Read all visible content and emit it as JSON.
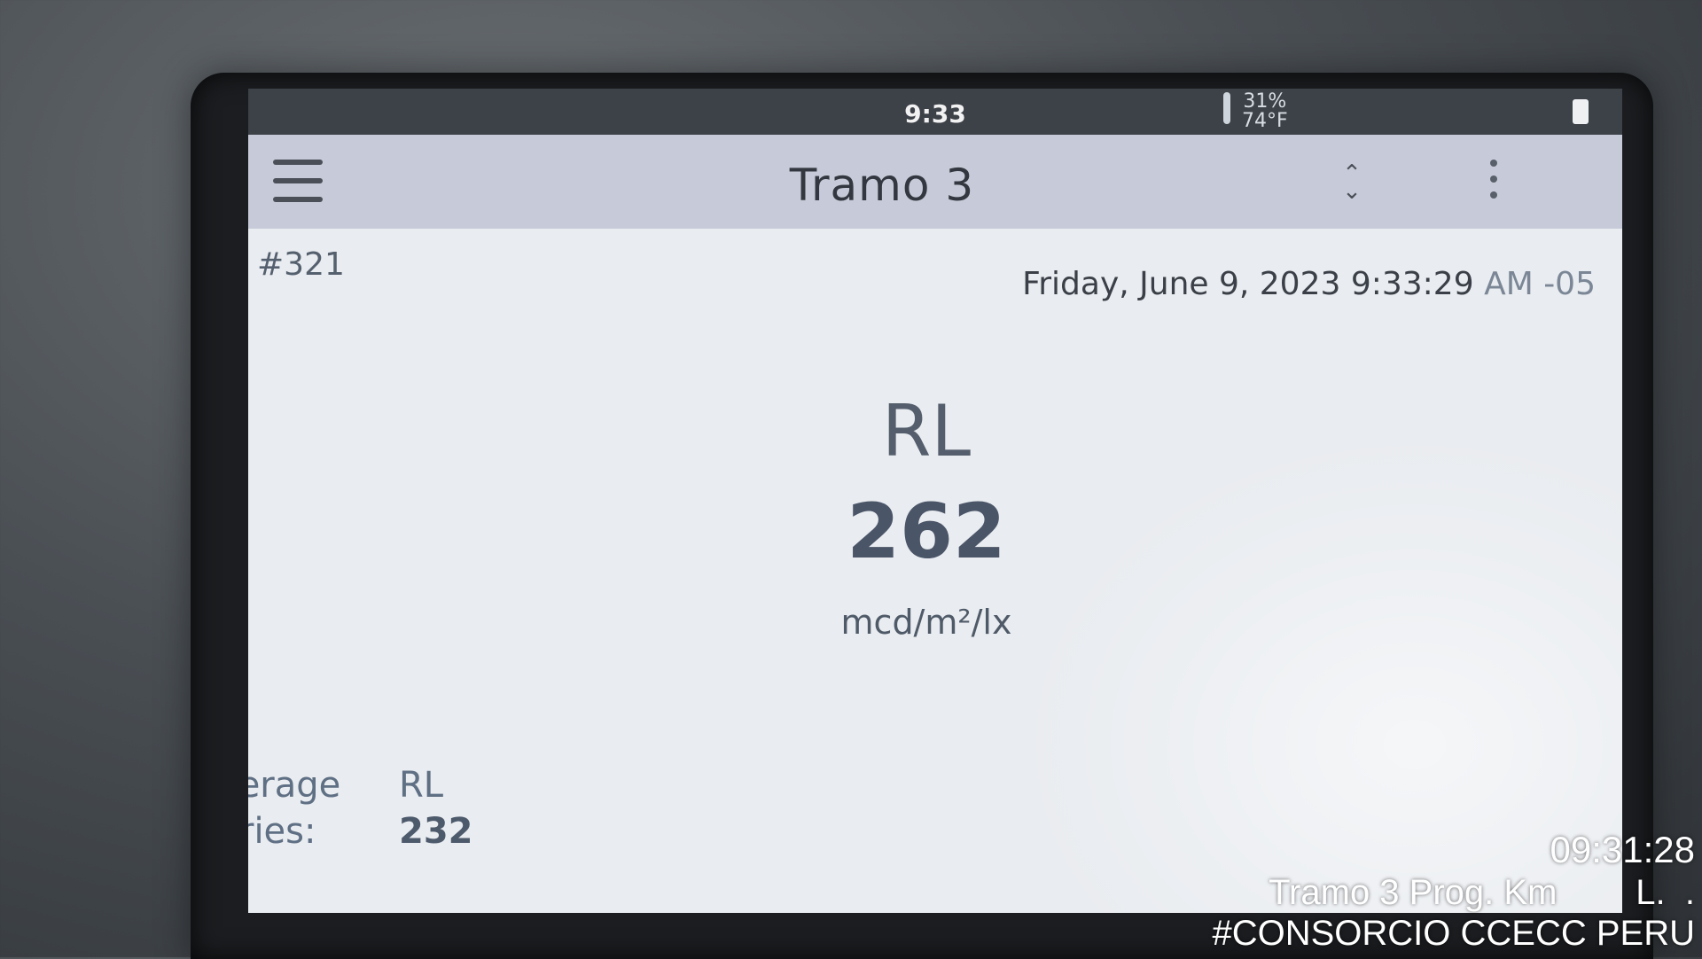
{
  "status_bar": {
    "time": "9:33",
    "humidity": "31%",
    "temperature": "74°F"
  },
  "app_bar": {
    "title": "Tramo 3",
    "menu_icon": "hamburger-menu-icon",
    "sort_icon": "up-down-chevron-icon",
    "more_icon": "vertical-dots-icon"
  },
  "measurement": {
    "record_id": "#321",
    "datetime_main": "Friday, June 9, 2023 9:33:29",
    "datetime_tz": "AM -05",
    "label": "RL",
    "value": "262",
    "unit": "mcd/m²/lx"
  },
  "average": {
    "label_line1": "Average",
    "label_line2": "Series:",
    "metric": "RL",
    "value": "232"
  },
  "photo_overlay": {
    "timestamp": "09:31:28",
    "location": "Tramo 3 Prog. Km        L.  .",
    "tag": "#CONSORCIO CCECC PERU"
  }
}
